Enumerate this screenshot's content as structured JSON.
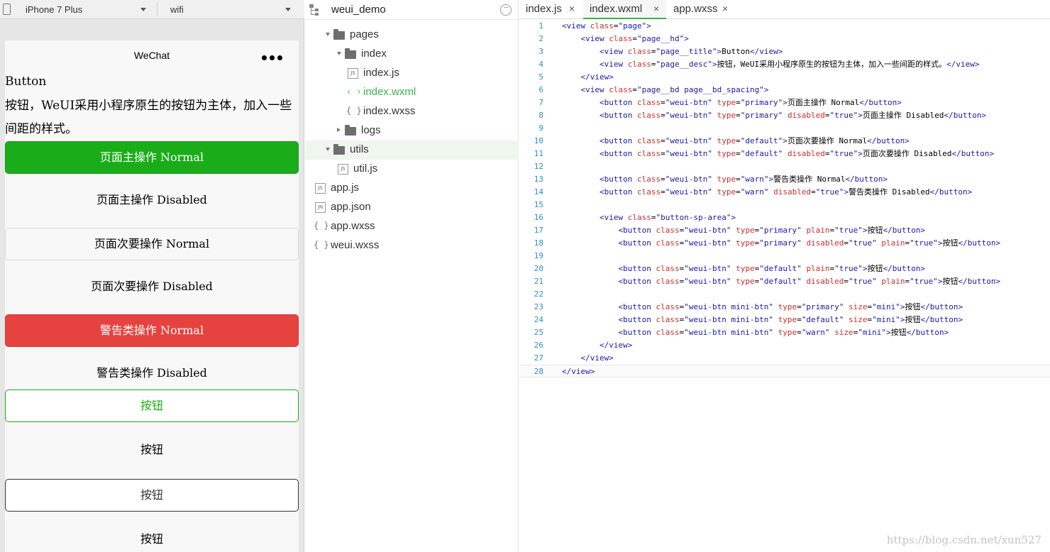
{
  "simulator": {
    "device": "iPhone 7 Plus",
    "network": "wifi",
    "nav_title": "WeChat",
    "page_title": "Button",
    "page_desc": "按钮，WeUI采用小程序原生的按钮为主体，加入一些间距的样式。",
    "buttons": [
      {
        "label": "页面主操作 Normal",
        "style": "primary"
      },
      {
        "label": "页面主操作 Disabled",
        "style": "primary-disabled"
      },
      {
        "label": "页面次要操作 Normal",
        "style": "default"
      },
      {
        "label": "页面次要操作 Disabled",
        "style": "default-disabled"
      },
      {
        "label": "警告类操作 Normal",
        "style": "warn"
      },
      {
        "label": "警告类操作 Disabled",
        "style": "warn-disabled"
      },
      {
        "label": "按钮",
        "style": "plain-primary"
      },
      {
        "label": "按钮",
        "style": "plain-primary-disabled"
      },
      {
        "label": "按钮",
        "style": "plain-default"
      },
      {
        "label": "按钮",
        "style": "plain-default-disabled"
      }
    ]
  },
  "project": {
    "name": "weui_demo",
    "tree": [
      {
        "label": "pages",
        "kind": "folder",
        "expanded": true,
        "indent": 1
      },
      {
        "label": "index",
        "kind": "folder",
        "expanded": true,
        "indent": 2
      },
      {
        "label": "index.js",
        "kind": "js",
        "indent": 3
      },
      {
        "label": "index.wxml",
        "kind": "wxml",
        "indent": 3,
        "active": true
      },
      {
        "label": "index.wxss",
        "kind": "wxss",
        "indent": 3
      },
      {
        "label": "logs",
        "kind": "folder",
        "expanded": false,
        "indent": 2
      },
      {
        "label": "utils",
        "kind": "folder",
        "expanded": true,
        "indent": 1,
        "selected": true
      },
      {
        "label": "util.js",
        "kind": "js",
        "indent": 2
      },
      {
        "label": "app.js",
        "kind": "js",
        "indent": 0
      },
      {
        "label": "app.json",
        "kind": "json",
        "indent": 0
      },
      {
        "label": "app.wxss",
        "kind": "wxss",
        "indent": 0
      },
      {
        "label": "weui.wxss",
        "kind": "wxss",
        "indent": 0
      }
    ],
    "icons": {
      "js": "JS",
      "json": "JN",
      "wxml": "‹ ›",
      "wxss": "{ }"
    }
  },
  "editor": {
    "tabs": [
      {
        "label": "index.js",
        "active": false
      },
      {
        "label": "index.wxml",
        "active": true
      },
      {
        "label": "app.wxss",
        "active": false
      }
    ],
    "close_glyph": "×",
    "lines": [
      "<view class=\"page\">",
      "    <view class=\"page__hd\">",
      "        <view class=\"page__title\">Button</view>",
      "        <view class=\"page__desc\">按钮，WeUI采用小程序原生的按钮为主体，加入一些间距的样式。</view>",
      "    </view>",
      "    <view class=\"page__bd page__bd_spacing\">",
      "        <button class=\"weui-btn\" type=\"primary\">页面主操作 Normal</button>",
      "        <button class=\"weui-btn\" type=\"primary\" disabled=\"true\">页面主操作 Disabled</button>",
      "",
      "        <button class=\"weui-btn\" type=\"default\">页面次要操作 Normal</button>",
      "        <button class=\"weui-btn\" type=\"default\" disabled=\"true\">页面次要操作 Disabled</button>",
      "",
      "        <button class=\"weui-btn\" type=\"warn\">警告类操作 Normal</button>",
      "        <button class=\"weui-btn\" type=\"warn\" disabled=\"true\">警告类操作 Disabled</button>",
      "",
      "        <view class=\"button-sp-area\">",
      "            <button class=\"weui-btn\" type=\"primary\" plain=\"true\">按钮</button>",
      "            <button class=\"weui-btn\" type=\"primary\" disabled=\"true\" plain=\"true\">按钮</button>",
      "",
      "            <button class=\"weui-btn\" type=\"default\" plain=\"true\">按钮</button>",
      "            <button class=\"weui-btn\" type=\"default\" disabled=\"true\" plain=\"true\">按钮</button>",
      "",
      "            <button class=\"weui-btn mini-btn\" type=\"primary\" size=\"mini\">按钮</button>",
      "            <button class=\"weui-btn mini-btn\" type=\"default\" size=\"mini\">按钮</button>",
      "            <button class=\"weui-btn mini-btn\" type=\"warn\" size=\"mini\">按钮</button>",
      "        </view>",
      "    </view>",
      "</view>"
    ],
    "cursor_line": 28
  },
  "watermark": "https://blog.csdn.net/xun527",
  "colors": {
    "primary": "#1aad19",
    "warn": "#e64340",
    "accent": "#3cb24a",
    "line_number": "#2f8fc4"
  }
}
